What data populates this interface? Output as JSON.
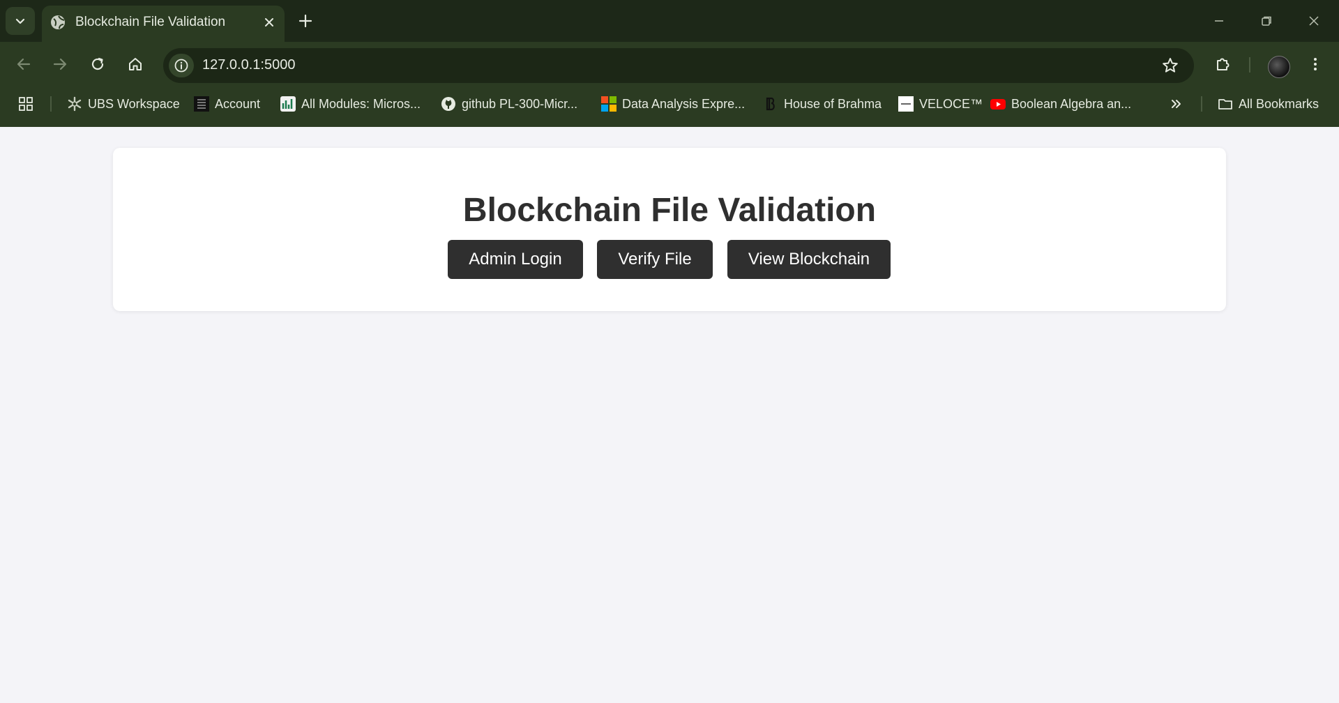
{
  "browser": {
    "tab": {
      "title": "Blockchain File Validation",
      "favicon": "globe-icon"
    },
    "address_bar": {
      "url": "127.0.0.1:5000"
    },
    "bookmarks": [
      {
        "label": "UBS Workspace",
        "icon": "ubs-icon"
      },
      {
        "label": "Account",
        "icon": "house-of-bare-icon"
      },
      {
        "label": "All Modules: Micros...",
        "icon": "modules-icon"
      },
      {
        "label": "github PL-300-Micr...",
        "icon": "github-icon"
      },
      {
        "label": "Data Analysis Expre...",
        "icon": "microsoft-icon"
      },
      {
        "label": "House of Brahma",
        "icon": "brahma-icon"
      },
      {
        "label": "VELOCE™",
        "icon": "veloce-icon"
      },
      {
        "label": "Boolean Algebra an...",
        "icon": "youtube-icon"
      }
    ],
    "all_bookmarks_label": "All Bookmarks",
    "colors": {
      "tabstrip": "#1d2818",
      "toolbar": "#2b3b22",
      "omnibox": "#1c2716"
    }
  },
  "page": {
    "title": "Blockchain File Validation",
    "buttons": {
      "admin_login": "Admin Login",
      "verify_file": "Verify File",
      "view_blockchain": "View Blockchain"
    },
    "colors": {
      "background": "#f4f4f8",
      "card": "#ffffff",
      "button": "#2f2f2f",
      "button_text": "#ffffff"
    }
  }
}
